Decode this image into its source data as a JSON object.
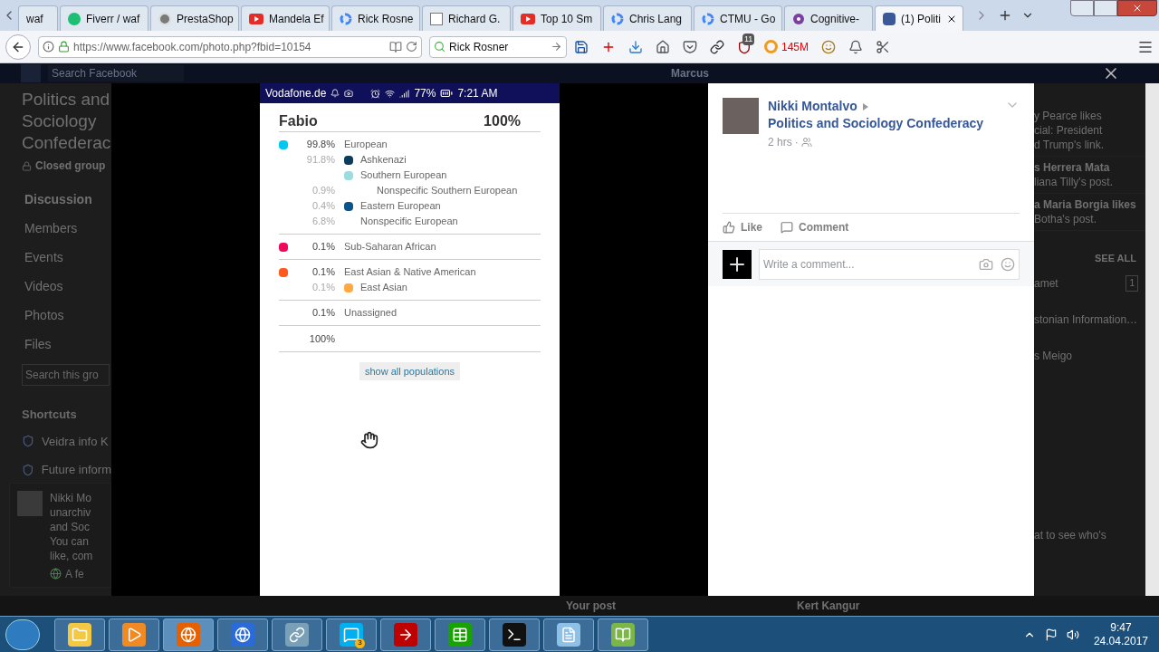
{
  "browser": {
    "tabs": [
      {
        "title": "waf",
        "kind": "plain",
        "selected": false
      },
      {
        "title": "Fiverr / waf",
        "kind": "fiverr",
        "selected": false
      },
      {
        "title": "PrestaShop",
        "kind": "presta",
        "selected": false
      },
      {
        "title": "Mandela Ef",
        "kind": "youtube",
        "selected": false
      },
      {
        "title": "Rick Rosne",
        "kind": "google",
        "selected": false
      },
      {
        "title": "Richard G.",
        "kind": "wiki",
        "selected": false
      },
      {
        "title": "Top 10 Sm",
        "kind": "youtube",
        "selected": false
      },
      {
        "title": "Chris Lang",
        "kind": "google",
        "selected": false
      },
      {
        "title": "CTMU - Go",
        "kind": "google",
        "selected": false
      },
      {
        "title": "Cognitive-",
        "kind": "cognitive",
        "selected": false
      },
      {
        "title": "(1) Politi",
        "kind": "facebook",
        "selected": true
      }
    ],
    "url": "https://www.facebook.com/photo.php?fbid=10154",
    "search_value": "Rick Rosner",
    "addon_badge": "11",
    "addon_counter": "145M"
  },
  "page": {
    "search_placeholder": "Search Facebook",
    "header_name": "Marcus",
    "group_title_lines": [
      "Politics and",
      "Sociology",
      "Confederac"
    ],
    "privacy": "Closed group",
    "nav": [
      {
        "label": "Discussion",
        "selected": true
      },
      {
        "label": "Members",
        "selected": false
      },
      {
        "label": "Events",
        "selected": false
      },
      {
        "label": "Videos",
        "selected": false
      },
      {
        "label": "Photos",
        "selected": false
      },
      {
        "label": "Files",
        "selected": false
      }
    ],
    "group_search_placeholder": "Search this gro",
    "shortcuts_heading": "Shortcuts",
    "shortcuts": [
      "Veidra info K",
      "Future inform"
    ],
    "notification_lines": [
      "Nikki Mo",
      "unarchiv",
      "and Soc",
      "You can",
      "like, com"
    ],
    "notification_time": "A fe",
    "activity": [
      [
        "y Pearce likes",
        "cial: President",
        "d Trump's link."
      ],
      [
        "s Herrera Mata",
        "liana Tilly's post."
      ],
      [
        "a Maria Borgia likes",
        "Botha's post."
      ]
    ],
    "see_all": "SEE ALL",
    "contacts": [
      {
        "name": "amet",
        "count": "1"
      },
      {
        "name": "stonian Information…"
      },
      {
        "name": "s Meigo"
      }
    ],
    "chat_hint": "at to see who's",
    "bottom_post": "Your post",
    "bottom_name": "Kert Kangur"
  },
  "photo": {
    "carrier": "Vodafone.de",
    "battery": "77%",
    "time": "7:21 AM",
    "name": "Fabio",
    "total_header": "100%",
    "populations": [
      {
        "pct": "99.8%",
        "label": "European",
        "color": "#00c8f0",
        "children": [
          {
            "pct": "91.8%",
            "label": "Ashkenazi",
            "color": "#0b3c5d"
          },
          {
            "label": "Southern European",
            "color": "#99dde0",
            "children": [
              {
                "pct": "0.9%",
                "label": "Nonspecific Southern European"
              }
            ]
          },
          {
            "pct": "0.4%",
            "label": "Eastern European",
            "color": "#0c5488"
          },
          {
            "pct": "6.8%",
            "label": "Nonspecific European"
          }
        ]
      },
      {
        "pct": "0.1%",
        "label": "Sub-Saharan African",
        "color": "#f0085a"
      },
      {
        "pct": "0.1%",
        "label": "East Asian & Native American",
        "color": "#ff5a1e",
        "children": [
          {
            "pct": "0.1%",
            "label": "East Asian",
            "color": "#ffaa40"
          }
        ]
      },
      {
        "pct": "0.1%",
        "label": "Unassigned"
      }
    ],
    "total": "100%",
    "show_all": "show all populations"
  },
  "post": {
    "author": "Nikki Montalvo",
    "group": "Politics and Sociology Confederacy",
    "time": "2 hrs",
    "separator": "·",
    "like": "Like",
    "comment": "Comment",
    "comment_placeholder": "Write a comment..."
  },
  "taskbar": {
    "apps": [
      {
        "kind": "explorer",
        "selected": false
      },
      {
        "kind": "media",
        "selected": false
      },
      {
        "kind": "firefox",
        "selected": true
      },
      {
        "kind": "browser2",
        "selected": false
      },
      {
        "kind": "network",
        "selected": false
      },
      {
        "kind": "skype",
        "selected": false,
        "badge": "3"
      },
      {
        "kind": "filezilla",
        "selected": false
      },
      {
        "kind": "calc",
        "selected": false
      },
      {
        "kind": "terminal",
        "selected": false
      },
      {
        "kind": "notepad",
        "selected": false
      },
      {
        "kind": "editor",
        "selected": false
      }
    ],
    "time": "9:47",
    "date": "24.04.2017"
  }
}
